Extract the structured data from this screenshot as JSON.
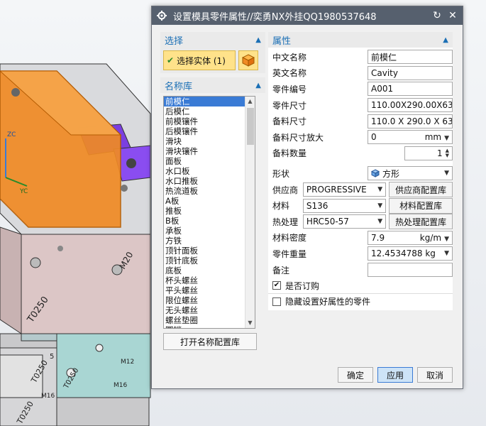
{
  "dialog": {
    "title": "设置模具零件属性//奕勇NX外挂QQ1980537648"
  },
  "selection": {
    "header": "选择",
    "select_label": "选择实体 (1)"
  },
  "name_library": {
    "header": "名称库",
    "items": [
      "前模仁",
      "后模仁",
      "前模镶件",
      "后模镶件",
      "滑块",
      "滑块镶件",
      "面板",
      "水口板",
      "水口推板",
      "热流道板",
      "A板",
      "推板",
      "B板",
      "承板",
      "方铁",
      "顶针面板",
      "顶针底板",
      "底板",
      "杯头螺丝",
      "平头螺丝",
      "限位螺丝",
      "无头螺丝",
      "螺丝垫圈",
      "圆销"
    ],
    "open_button": "打开名称配置库"
  },
  "properties": {
    "header": "属性",
    "chinese_name_label": "中文名称",
    "chinese_name": "前模仁",
    "english_name_label": "英文名称",
    "english_name": "Cavity",
    "part_no_label": "零件编号",
    "part_no": "A001",
    "part_size_label": "零件尺寸",
    "part_size": "110.00X290.00X63.41",
    "stock_size_label": "备料尺寸",
    "stock_size": "110.0 X 290.0 X 63.4",
    "stock_enlarge_label": "备料尺寸放大",
    "stock_enlarge_value": "0",
    "stock_enlarge_unit": "mm",
    "stock_qty_label": "备料数量",
    "stock_qty": "1",
    "shape_label": "形状",
    "shape_value": "方形",
    "supplier_label": "供应商",
    "supplier_value": "PROGRESSIVE",
    "supplier_btn": "供应商配置库",
    "material_label": "材料",
    "material_value": "S136",
    "material_btn": "材料配置库",
    "heat_label": "热处理",
    "heat_value": "HRC50-57",
    "heat_btn": "热处理配置库",
    "density_label": "材料密度",
    "density_value": "7.9",
    "density_unit": "kg/m",
    "weight_label": "零件重量",
    "weight_value": "12.4534788",
    "weight_unit": "kg",
    "note_label": "备注",
    "note_value": "",
    "order_label": "是否订购",
    "order_checked": true,
    "hide_label": "隐藏设置好属性的零件",
    "hide_checked": false
  },
  "footer": {
    "ok": "确定",
    "apply": "应用",
    "cancel": "取消"
  },
  "viewport": {
    "labels": {
      "zc": "ZC",
      "yc": "YC",
      "m20": "M20",
      "t0250_a": "T0250",
      "t0250_b": "T0250",
      "t0250_c": "T0250",
      "t0250_d": "T0250",
      "m16_a": "M16",
      "m16_b": "M16",
      "m12": "M12",
      "num5": "5"
    }
  }
}
